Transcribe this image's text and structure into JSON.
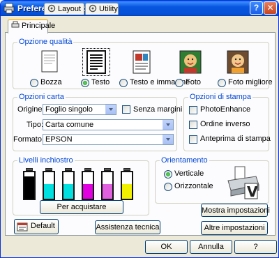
{
  "window": {
    "title": "Preferenze stampa",
    "help_label": "?",
    "close_label": "x"
  },
  "tabs": [
    {
      "label": "Principale",
      "active": true
    },
    {
      "label": "Layout",
      "active": false
    },
    {
      "label": "Utility",
      "active": false
    }
  ],
  "quality": {
    "label": "Opzione qualità",
    "options": [
      {
        "label": "Bozza",
        "selected": false,
        "icon": "draft-page-icon"
      },
      {
        "label": "Testo",
        "selected": true,
        "icon": "text-page-icon"
      },
      {
        "label": "Testo e immagine",
        "selected": false,
        "icon": "text-image-page-icon"
      },
      {
        "label": "Foto",
        "selected": false,
        "icon": "photo-icon"
      },
      {
        "label": "Foto migliore",
        "selected": false,
        "icon": "best-photo-icon"
      }
    ]
  },
  "paper": {
    "label": "Opzioni carta",
    "origin_label": "Origine:",
    "origin_value": "Foglio singolo",
    "borderless_label": "Senza margini",
    "type_label": "Tipo:",
    "type_value": "Carta comune",
    "format_label": "Formato:",
    "format_value": "EPSON"
  },
  "print_options": {
    "label": "Opzioni di stampa",
    "photo_enhance": "PhotoEnhance",
    "reverse_order": "Ordine inverso",
    "preview": "Anteprima di stampa"
  },
  "ink": {
    "label": "Livelli inchiostro",
    "buy_label": "Per acquistare",
    "cartridges": [
      {
        "color": "#000000",
        "level": 0.85
      },
      {
        "color": "#00e0e0",
        "level": 0.55
      },
      {
        "color": "#00e0e0",
        "level": 0.55
      },
      {
        "color": "#e000e0",
        "level": 0.55
      },
      {
        "color": "#e060e0",
        "level": 0.55
      },
      {
        "color": "#f0f000",
        "level": 0.55
      }
    ]
  },
  "orientation": {
    "label": "Orientamento",
    "portrait": "Verticale",
    "landscape": "Orizzontale",
    "selected": "portrait"
  },
  "buttons": {
    "show_settings": "Mostra impostazioni",
    "default": "Default",
    "support": "Assistenza tecnica",
    "more_settings": "Altre impostazioni",
    "ok": "OK",
    "cancel": "Annulla",
    "help": "?"
  },
  "colors": {
    "accent": "#0046d5",
    "titlebar": "#0556e0"
  }
}
